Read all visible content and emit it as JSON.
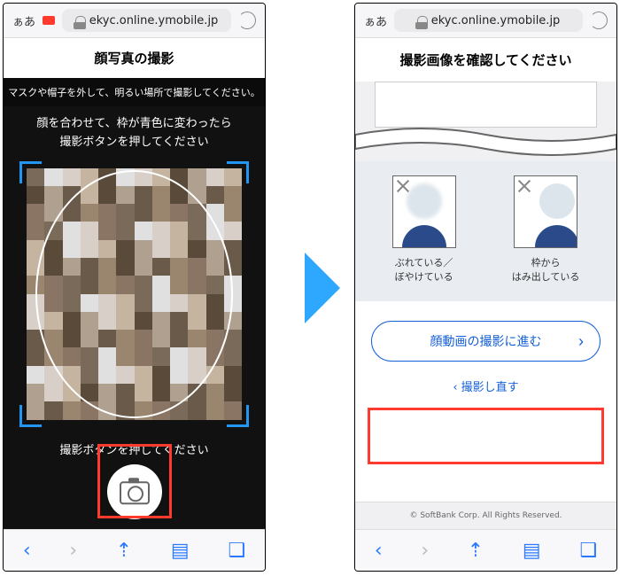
{
  "browser": {
    "aa": "ぁあ",
    "url": "ekyc.online.ymobile.jp"
  },
  "left": {
    "title": "顔写真の撮影",
    "sub1": "マスクや帽子を外して、明るい場所で撮影してください。",
    "sub2a": "顔を合わせて、枠が青色に変わったら",
    "sub2b": "撮影ボタンを押してください",
    "bottom": "撮影ボタンを押してください"
  },
  "right": {
    "title": "撮影画像を確認してください",
    "ex1a": "ぶれている／",
    "ex1b": "ぼやけている",
    "ex2a": "枠から",
    "ex2b": "はみ出している",
    "btn": "顔動画の撮影に進む",
    "retake": "撮影し直す",
    "copy": "© SoftBank Corp. All Rights Reserved."
  }
}
